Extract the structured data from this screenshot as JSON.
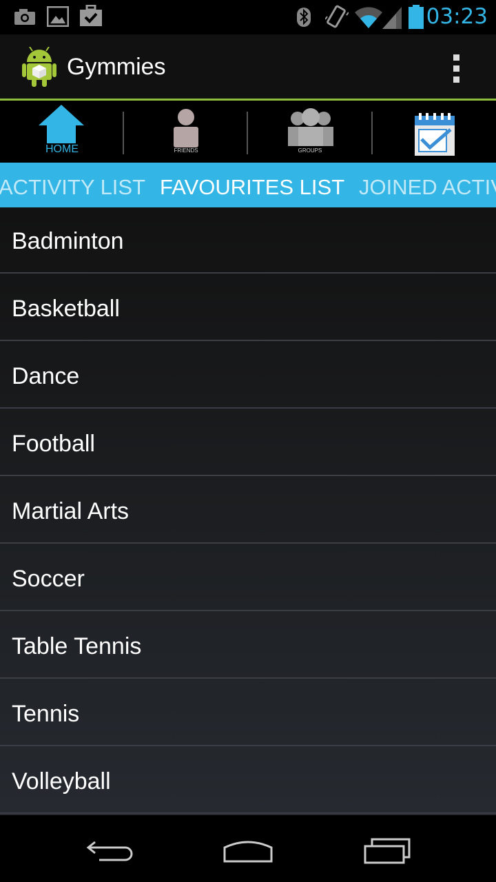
{
  "status_bar": {
    "time": "03:23",
    "left_icons": [
      "camera-icon",
      "gallery-icon",
      "briefcase-check-icon"
    ],
    "right_icons": [
      "bluetooth-icon",
      "vibrate-icon",
      "wifi-icon",
      "signal-icon",
      "battery-icon"
    ],
    "accent_color": "#33b5e5"
  },
  "action_bar": {
    "title": "Gymmies",
    "app_icon": "android-icon",
    "overflow_icon": "overflow-menu-icon"
  },
  "icon_tabs": [
    {
      "name": "home",
      "label": "HOME",
      "icon": "home-icon"
    },
    {
      "name": "friends",
      "label": "FRIENDS",
      "icon": "person-icon"
    },
    {
      "name": "groups",
      "label": "GROUPS",
      "icon": "group-icon"
    },
    {
      "name": "activities",
      "label": "",
      "icon": "calendar-check-icon",
      "selected": true
    }
  ],
  "text_tabs": {
    "items": [
      "ACTIVITY LIST",
      "FAVOURITES LIST",
      "JOINED ACTIV"
    ],
    "active": "FAVOURITES LIST"
  },
  "list": {
    "items": [
      "Badminton",
      "Basketball",
      "Dance",
      "Football",
      "Martial Arts",
      "Soccer",
      "Table Tennis",
      "Tennis",
      "Volleyball"
    ]
  },
  "nav_bar": {
    "icons": [
      "back-icon",
      "home-nav-icon",
      "recent-apps-icon"
    ]
  }
}
